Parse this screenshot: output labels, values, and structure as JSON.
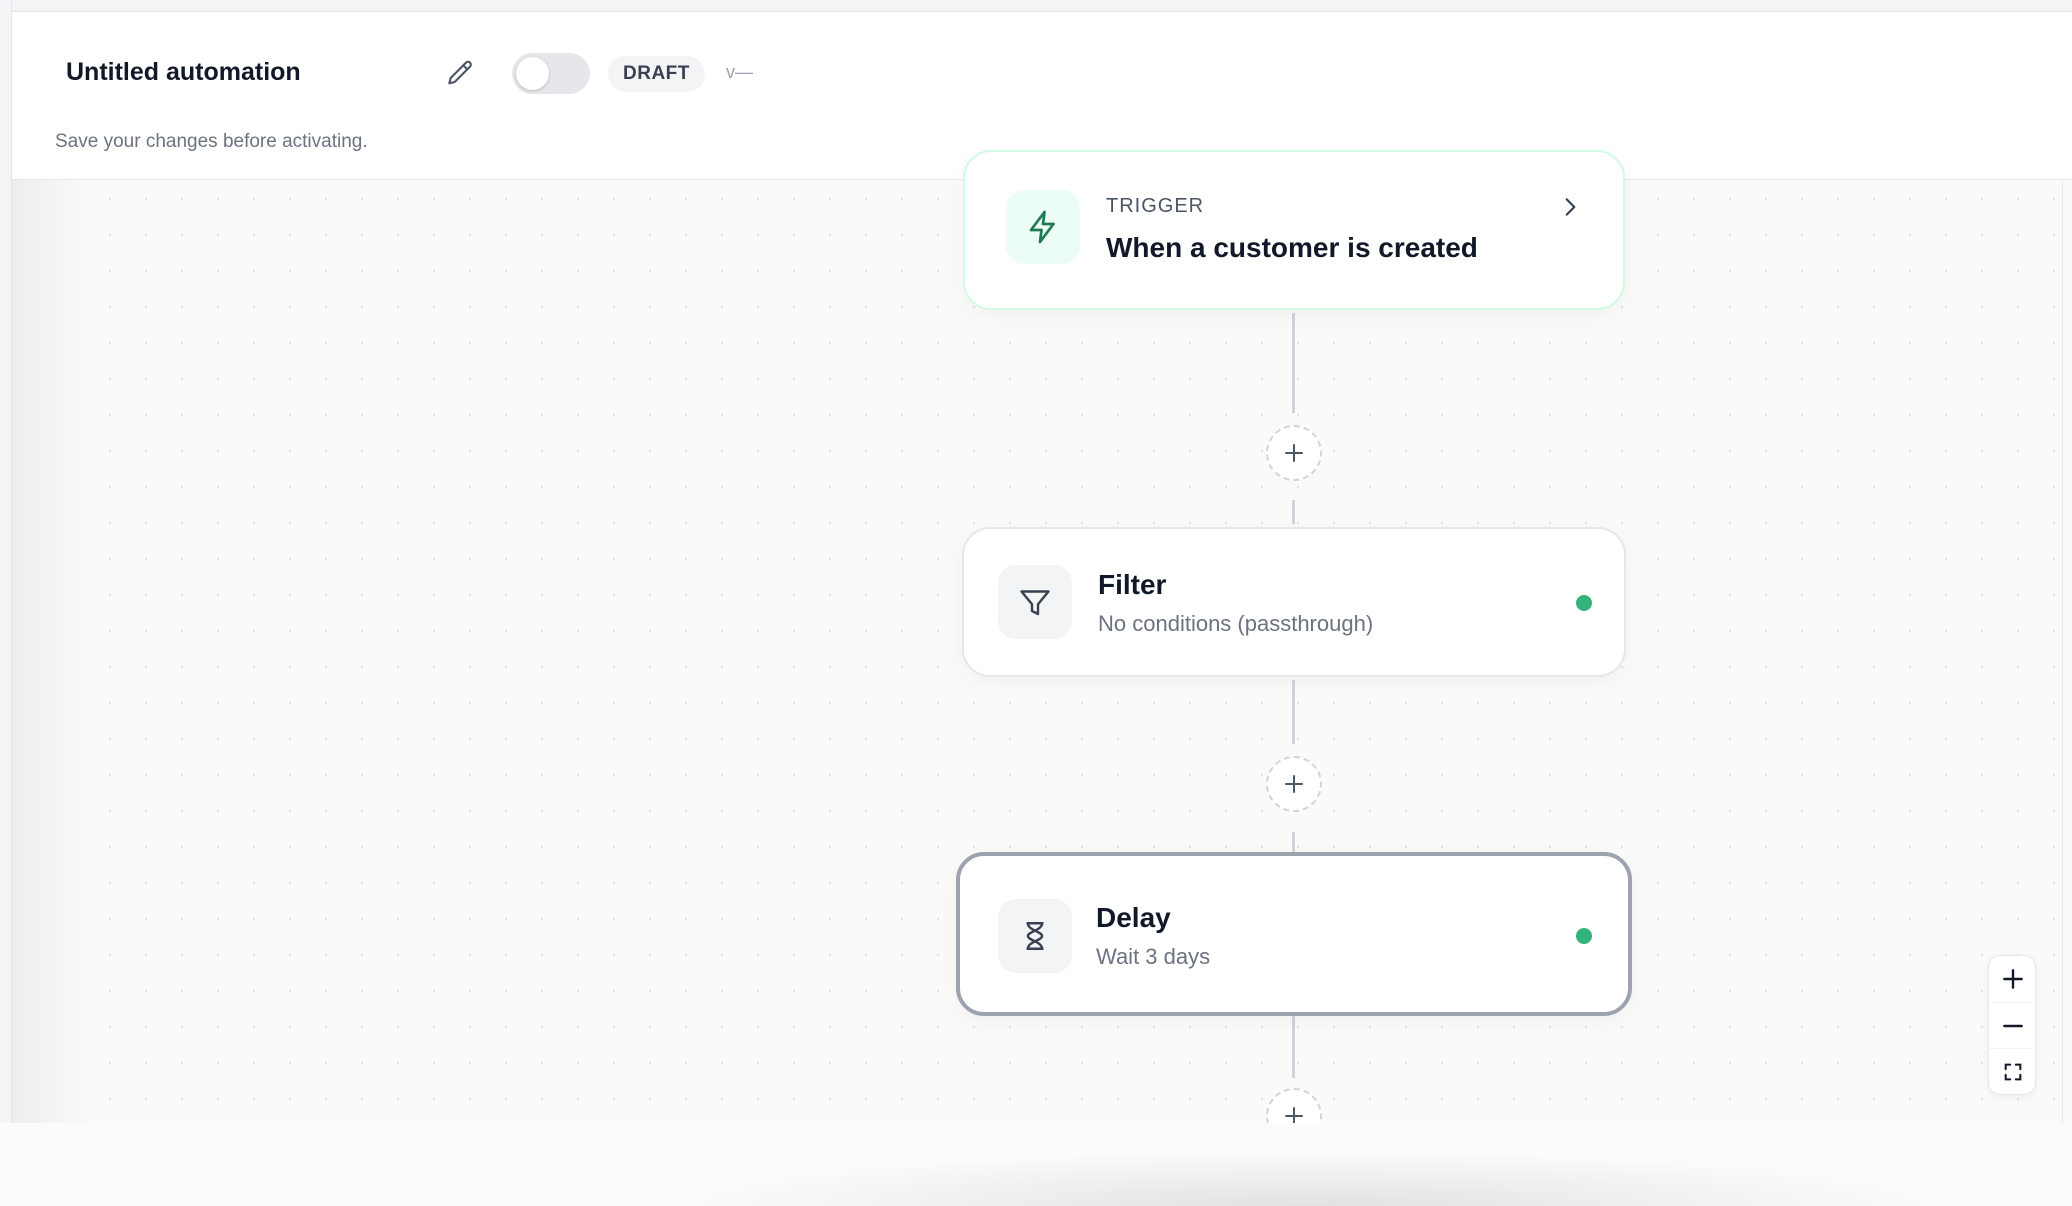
{
  "header": {
    "title": "Untitled automation",
    "status_badge": "DRAFT",
    "version": "v—",
    "subtitle": "Save your changes before activating.",
    "active_toggle": false
  },
  "nodes": {
    "trigger": {
      "kicker": "TRIGGER",
      "title": "When a customer is created",
      "icon": "lightning-icon"
    },
    "filter": {
      "title": "Filter",
      "subtitle": "No conditions (passthrough)",
      "icon": "funnel-icon",
      "status": "ok"
    },
    "delay": {
      "title": "Delay",
      "subtitle": "Wait 3 days",
      "icon": "hourglass-icon",
      "status": "ok",
      "selected": true
    }
  },
  "colors": {
    "status_ok": "#34b37a",
    "trigger_accent": "#1f7a55"
  }
}
